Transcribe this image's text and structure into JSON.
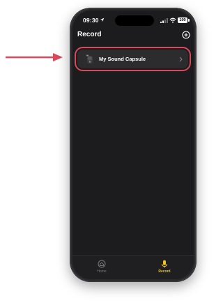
{
  "status_bar": {
    "time": "09:30",
    "battery": "100",
    "icons": [
      "location-arrow-icon",
      "signal-icon",
      "wifi-icon",
      "battery-icon"
    ]
  },
  "header": {
    "title": "Record",
    "add_icon": "plus-circle-icon"
  },
  "list": {
    "items": [
      {
        "label": "My Sound Capsule",
        "icon": "sound-capsule-icon",
        "trailing_icon": "chevron-right-icon"
      }
    ]
  },
  "annotation": {
    "arrow_color": "#d9495a",
    "highlight_color": "#d9495a"
  },
  "tab_bar": {
    "tabs": [
      {
        "label": "Home",
        "icon": "home-icon",
        "active": false
      },
      {
        "label": "Record",
        "icon": "microphone-icon",
        "active": true
      }
    ],
    "active_color": "#f0c419",
    "inactive_color": "#7a7a7e"
  }
}
